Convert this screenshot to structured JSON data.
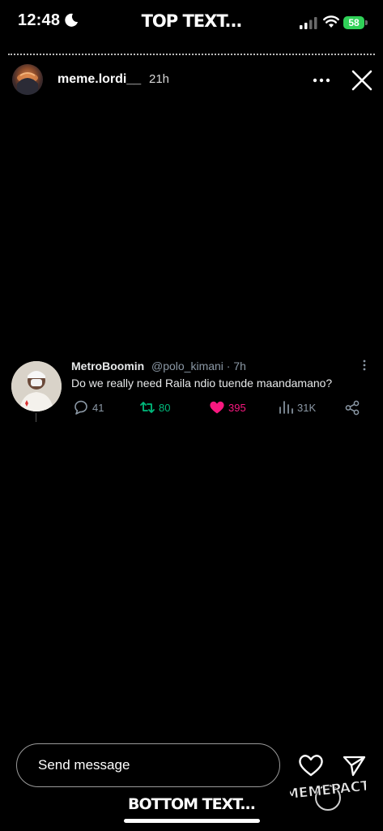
{
  "status_bar": {
    "time": "12:48",
    "battery": "58",
    "battery_color": "#30d158"
  },
  "meme": {
    "top_text": "TOP TEXT...",
    "bottom_text": "BOTTOM TEXT..."
  },
  "story": {
    "username": "meme.lordi__",
    "time_ago": "21h",
    "icons": [
      "moon-icon",
      "cellular-signal-icon",
      "wifi-icon",
      "battery-icon",
      "more-icon",
      "close-icon"
    ]
  },
  "tweet": {
    "display_name": "MetroBoomin",
    "handle_time": "@polo_kimani · 7h",
    "text": "Do we really need Raila ndio tuende maandamano?",
    "replies": "41",
    "retweets": "80",
    "likes": "395",
    "views": "31K",
    "colors": {
      "retweet": "#00ba7c",
      "like": "#f91880",
      "muted": "#8b98a5"
    }
  },
  "footer": {
    "send_placeholder": "Send message",
    "watermark": "MEMEPACT"
  }
}
